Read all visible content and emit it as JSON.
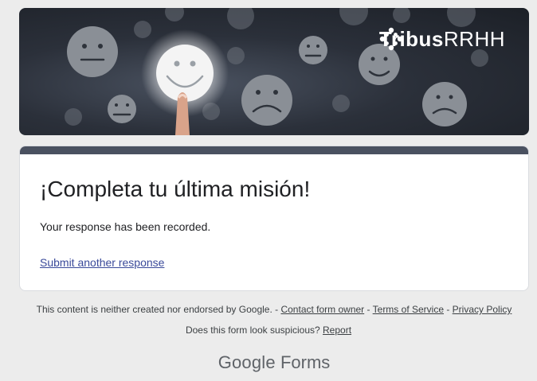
{
  "banner": {
    "logo_brand": "Tribus",
    "logo_suffix": "RRHH"
  },
  "card": {
    "title": "¡Completa tu última misión!",
    "message": "Your response has been recorded.",
    "submit_another": "Submit another response"
  },
  "footer": {
    "disclaimer": "This content is neither created nor endorsed by Google. - ",
    "contact_owner": "Contact form owner",
    "sep": " - ",
    "terms": "Terms of Service",
    "privacy": "Privacy Policy",
    "suspicious": "Does this form look suspicious? ",
    "report": "Report",
    "brand_google": "Google",
    "brand_forms": "Forms"
  },
  "colors": {
    "accent": "#4a5160",
    "link": "#3a4a9a",
    "background": "#ececec"
  }
}
